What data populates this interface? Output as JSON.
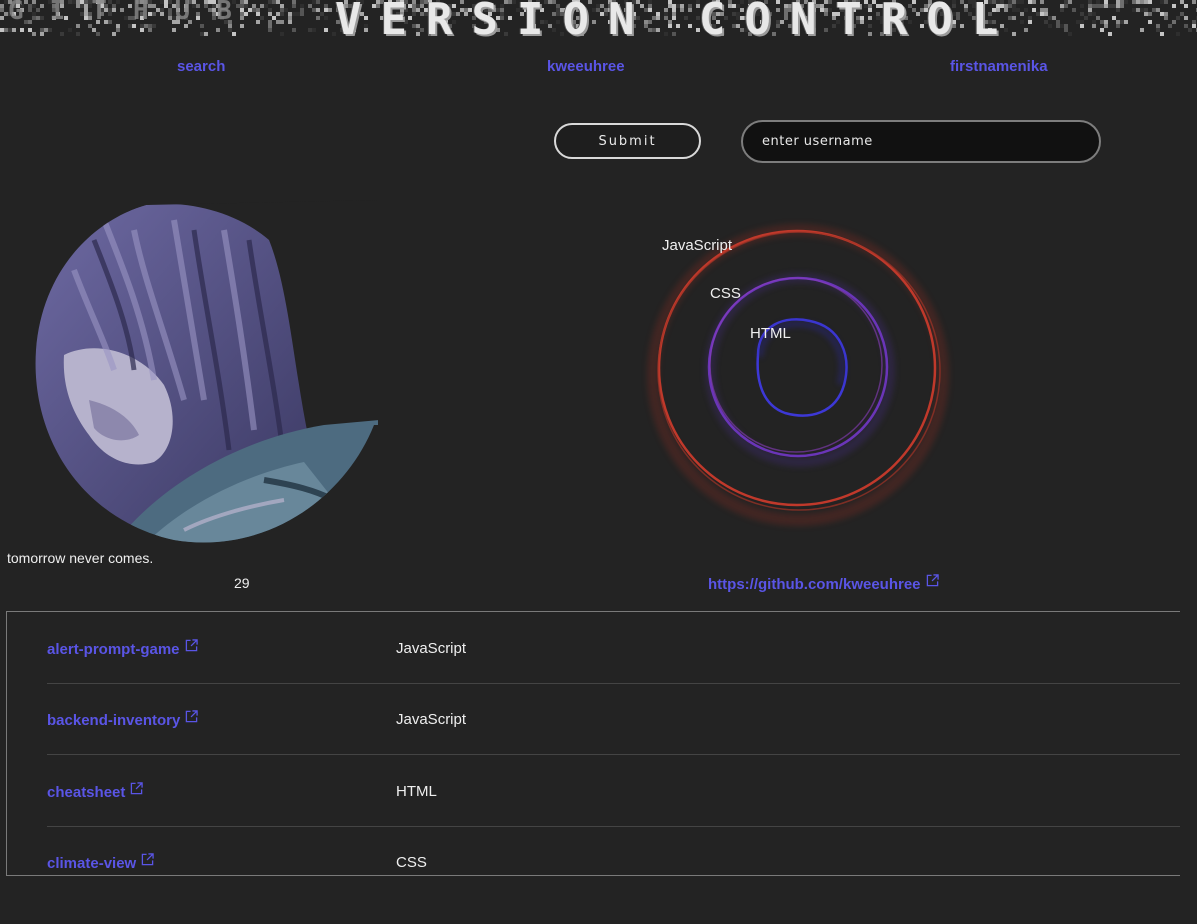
{
  "header": {
    "title": "VERSION CONTROL",
    "ghost_text": "GITHUB"
  },
  "nav": {
    "search": "search",
    "user1": "kweeuhree",
    "user2": "firstnamenika"
  },
  "form": {
    "submit_label": "Submit",
    "username_placeholder": "enter username"
  },
  "profile": {
    "bio": "tomorrow never comes.",
    "repo_count": "29",
    "github_url": "https://github.com/kweeuhree"
  },
  "languages": {
    "items": [
      {
        "name": "JavaScript",
        "color": "#c0392b"
      },
      {
        "name": "CSS",
        "color": "#6a35b8"
      },
      {
        "name": "HTML",
        "color": "#3d38d6"
      }
    ]
  },
  "repos": [
    {
      "name": "alert-prompt-game",
      "language": "JavaScript"
    },
    {
      "name": "backend-inventory",
      "language": "JavaScript"
    },
    {
      "name": "cheatsheet",
      "language": "HTML"
    },
    {
      "name": "climate-view",
      "language": "CSS"
    }
  ],
  "colors": {
    "link": "#5a55e6",
    "background": "#232323"
  },
  "icons": {
    "external_link": "external-link-icon"
  }
}
